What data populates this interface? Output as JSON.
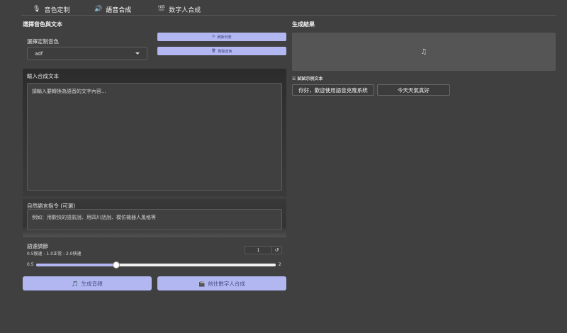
{
  "tabs": [
    {
      "label": "音色定制",
      "icon": "microphone-icon",
      "glyph": "🎙"
    },
    {
      "label": "語音合成",
      "icon": "speaker-icon",
      "glyph": "🔊"
    },
    {
      "label": "数字人合成",
      "icon": "clapperboard-icon",
      "glyph": "🎬"
    }
  ],
  "left": {
    "section_title": "選擇音色與文本",
    "voice_label": "選擇定制音色",
    "voice_selected": "adf",
    "refresh_button": "刷新列表",
    "delete_button": "刪除音色",
    "text_label": "輸入合成文本",
    "text_placeholder": "請輸入要轉換為語音的文字內容...",
    "instr_label": "自然語言指令 (可選)",
    "instr_placeholder": "例如：用歡快的語氣說、用四川話說、模仿機器人風格等",
    "speed_label": "語速調節",
    "speed_hint": "0.5慢速 - 1.0正常 - 2.0快速",
    "speed_value": "1",
    "speed_min": "0.5",
    "speed_max": "2",
    "speed_fraction": 0.333,
    "generate_button": "生成音頻",
    "generate_glyph": "🎵",
    "goto_button": "前往數字人合成",
    "goto_glyph": "🎬"
  },
  "right": {
    "section_title": "生成結果",
    "sample_label": "☰ 試試示例文本",
    "samples": [
      "你好，歡迎使用語音克隆系統",
      "今天天氣真好"
    ]
  },
  "colors": {
    "background": "#404040",
    "accent": "#b2b7f2",
    "accent_text": "#3a3f7a"
  }
}
